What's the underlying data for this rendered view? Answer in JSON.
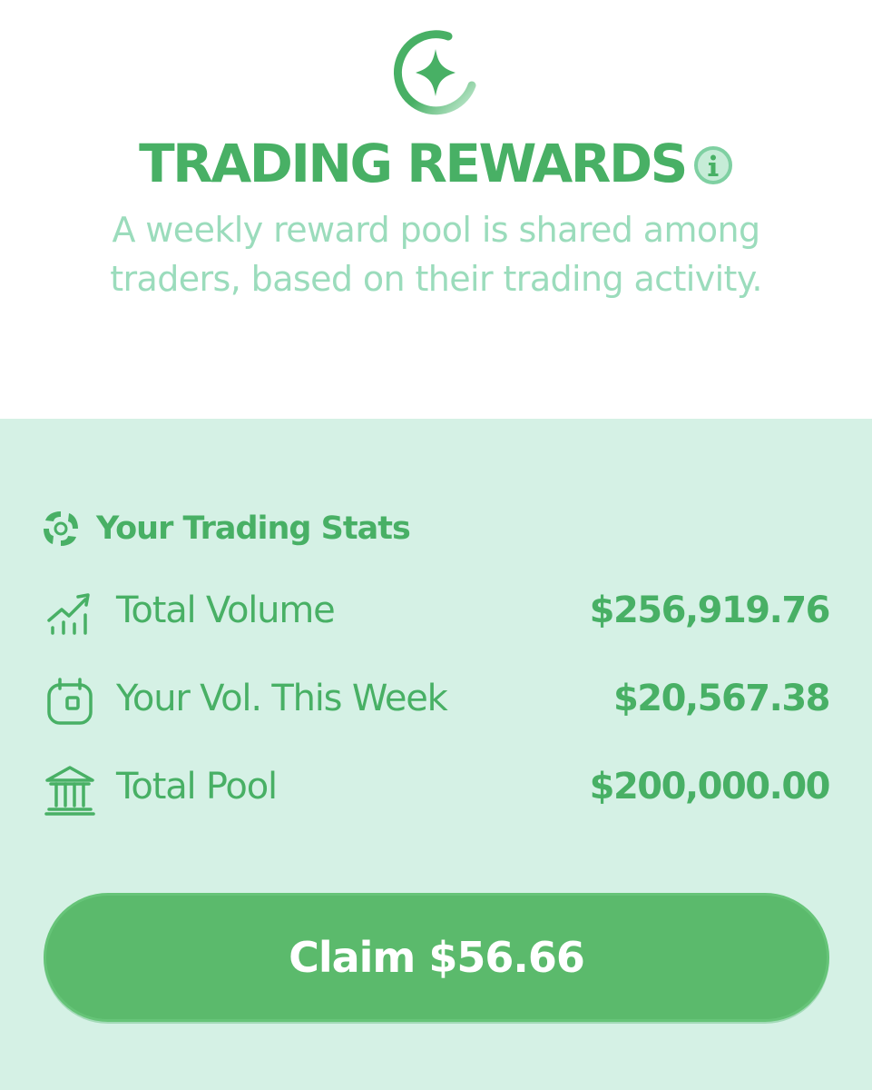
{
  "header": {
    "logo_icon": "sparkle-ring-icon",
    "title": "TRADING REWARDS",
    "info_icon": "info-icon",
    "subtitle": "A weekly reward pool is shared among traders, based on their trading activity."
  },
  "stats": {
    "header_icon": "swap-arrows-icon",
    "title": "Your Trading Stats",
    "rows": [
      {
        "icon": "chart-growth-icon",
        "label": "Total Volume",
        "value": "$256,919.76"
      },
      {
        "icon": "calendar-icon",
        "label": "Your Vol. This Week",
        "value": "$20,567.38"
      },
      {
        "icon": "bank-icon",
        "label": "Total Pool",
        "value": "$200,000.00"
      }
    ]
  },
  "claim": {
    "label": "Claim $56.66"
  },
  "colors": {
    "accent": "#48b065",
    "subtitle": "#9bdcbc",
    "panel_bg": "#d5f1e5",
    "button_bg": "#5bba6c"
  }
}
